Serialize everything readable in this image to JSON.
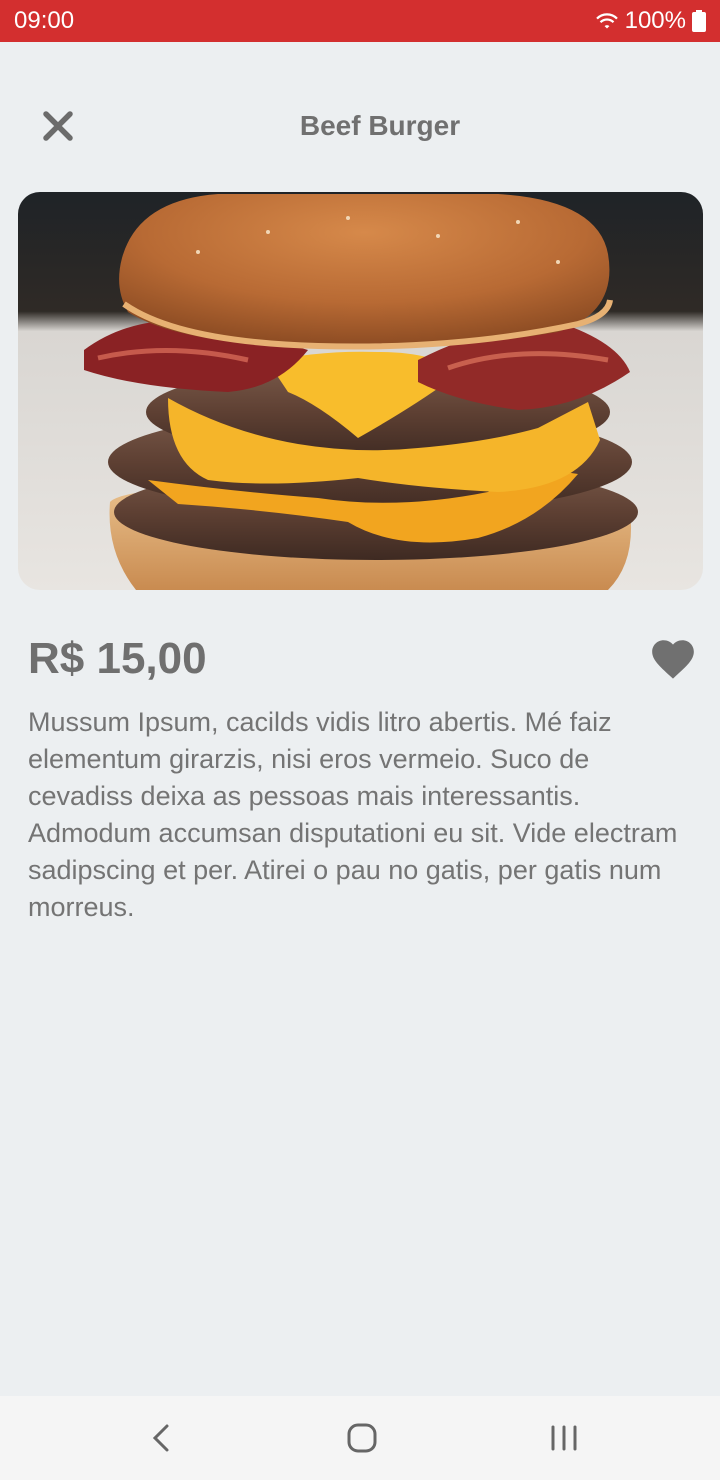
{
  "status_bar": {
    "time": "09:00",
    "battery": "100%",
    "wifi_icon": "wifi-icon",
    "battery_icon": "battery-icon"
  },
  "header": {
    "title": "Beef Burger",
    "close_icon": "close-icon"
  },
  "product": {
    "image_icon": "burger-photo",
    "price": "R$ 15,00",
    "favorite_icon": "heart-icon",
    "description": "Mussum Ipsum, cacilds vidis litro abertis. Mé faiz elementum girarzis, nisi eros vermeio. Suco de cevadiss deixa as pessoas mais interessantis. Admodum accumsan disputationi eu sit. Vide electram sadipscing et per. Atirei o pau no gatis, per gatis num morreus."
  },
  "nav_bar": {
    "back_icon": "back-icon",
    "home_icon": "home-icon",
    "recents_icon": "recents-icon"
  },
  "colors": {
    "status_bar": "#D32F2F",
    "background": "#ECEFF1",
    "text": "#707070"
  }
}
